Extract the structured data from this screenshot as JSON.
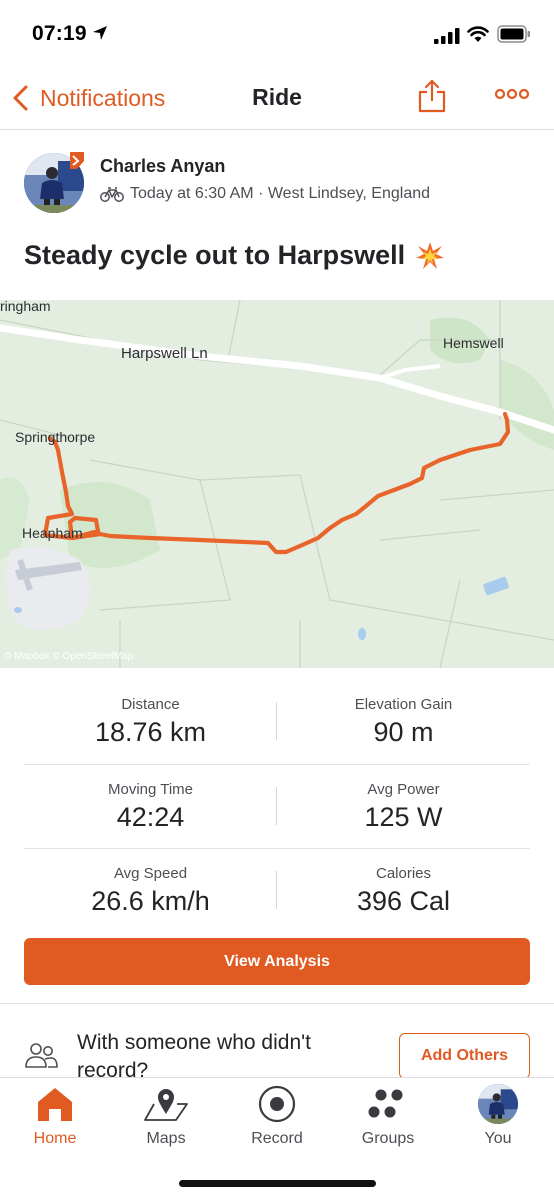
{
  "status_bar": {
    "time": "07:19"
  },
  "nav": {
    "back_label": "Notifications",
    "title": "Ride"
  },
  "activity": {
    "athlete_name": "Charles Anyan",
    "meta": "Today at 6:30 AM · West Lindsey, England",
    "title": "Steady cycle out to Harpswell",
    "type_icon": "bike-icon"
  },
  "map": {
    "labels": [
      "ringham",
      "Harpswell Ln",
      "Hemswell",
      "Springthorpe",
      "Heapham"
    ],
    "attribution": "© Mapbox © OpenStreetMap",
    "route_color": "#e8642a"
  },
  "stats": [
    [
      {
        "label": "Distance",
        "value": "18.76 km"
      },
      {
        "label": "Elevation Gain",
        "value": "90 m"
      }
    ],
    [
      {
        "label": "Moving Time",
        "value": "42:24"
      },
      {
        "label": "Avg Power",
        "value": "125 W"
      }
    ],
    [
      {
        "label": "Avg Speed",
        "value": "26.6 km/h"
      },
      {
        "label": "Calories",
        "value": "396 Cal"
      }
    ]
  ],
  "buttons": {
    "view_analysis": "View Analysis",
    "add_others": "Add Others"
  },
  "with_someone": "With someone who didn't record?",
  "tabs": [
    {
      "label": "Home",
      "icon": "home-icon",
      "active": true
    },
    {
      "label": "Maps",
      "icon": "map-icon",
      "active": false
    },
    {
      "label": "Record",
      "icon": "record-icon",
      "active": false
    },
    {
      "label": "Groups",
      "icon": "groups-icon",
      "active": false
    },
    {
      "label": "You",
      "icon": "avatar",
      "active": false
    }
  ],
  "colors": {
    "accent": "#e05a22",
    "text": "#242428",
    "muted": "#4e4e55"
  }
}
